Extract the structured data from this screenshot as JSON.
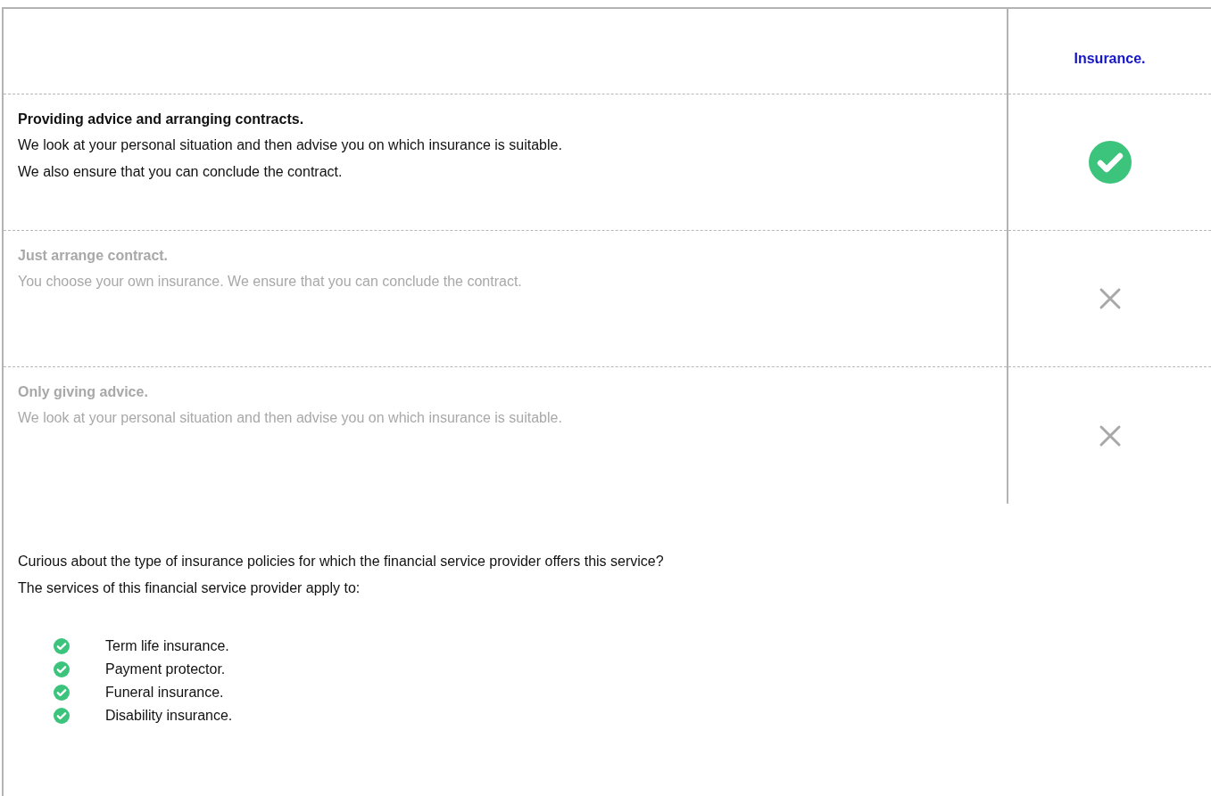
{
  "table": {
    "column_header": "Insurance.",
    "rows": [
      {
        "title": "Providing advice and arranging contracts.",
        "lines": [
          "We look at your personal situation and then advise you on which insurance is suitable.",
          "We also ensure that you can conclude the contract."
        ],
        "included": true
      },
      {
        "title": "Just arrange contract.",
        "lines": [
          "You choose your own insurance. We ensure that you can conclude the contract."
        ],
        "included": false
      },
      {
        "title": "Only giving advice.",
        "lines": [
          "We look at your personal situation and then advise you on which insurance is suitable."
        ],
        "included": false
      }
    ]
  },
  "intro": [
    "Curious about the type of insurance policies for which the financial service provider offers this service?",
    "The services of this financial service provider apply to:"
  ],
  "policies": [
    "Term life insurance.",
    "Payment protector.",
    "Funeral insurance.",
    "Disability insurance."
  ]
}
